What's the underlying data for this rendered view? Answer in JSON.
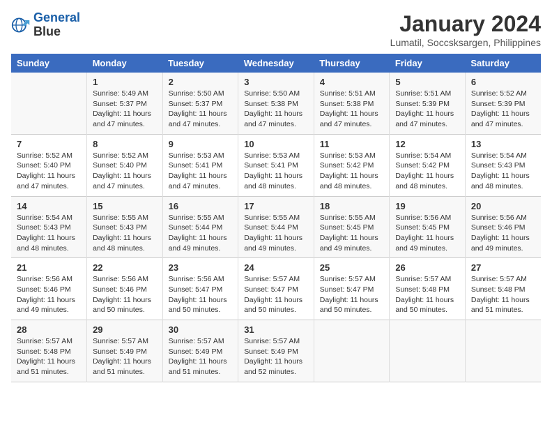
{
  "logo": {
    "line1": "General",
    "line2": "Blue"
  },
  "title": "January 2024",
  "location": "Lumatil, Soccsksargen, Philippines",
  "headers": [
    "Sunday",
    "Monday",
    "Tuesday",
    "Wednesday",
    "Thursday",
    "Friday",
    "Saturday"
  ],
  "weeks": [
    [
      {
        "day": "",
        "text": ""
      },
      {
        "day": "1",
        "text": "Sunrise: 5:49 AM\nSunset: 5:37 PM\nDaylight: 11 hours\nand 47 minutes."
      },
      {
        "day": "2",
        "text": "Sunrise: 5:50 AM\nSunset: 5:37 PM\nDaylight: 11 hours\nand 47 minutes."
      },
      {
        "day": "3",
        "text": "Sunrise: 5:50 AM\nSunset: 5:38 PM\nDaylight: 11 hours\nand 47 minutes."
      },
      {
        "day": "4",
        "text": "Sunrise: 5:51 AM\nSunset: 5:38 PM\nDaylight: 11 hours\nand 47 minutes."
      },
      {
        "day": "5",
        "text": "Sunrise: 5:51 AM\nSunset: 5:39 PM\nDaylight: 11 hours\nand 47 minutes."
      },
      {
        "day": "6",
        "text": "Sunrise: 5:52 AM\nSunset: 5:39 PM\nDaylight: 11 hours\nand 47 minutes."
      }
    ],
    [
      {
        "day": "7",
        "text": "Sunrise: 5:52 AM\nSunset: 5:40 PM\nDaylight: 11 hours\nand 47 minutes."
      },
      {
        "day": "8",
        "text": "Sunrise: 5:52 AM\nSunset: 5:40 PM\nDaylight: 11 hours\nand 47 minutes."
      },
      {
        "day": "9",
        "text": "Sunrise: 5:53 AM\nSunset: 5:41 PM\nDaylight: 11 hours\nand 47 minutes."
      },
      {
        "day": "10",
        "text": "Sunrise: 5:53 AM\nSunset: 5:41 PM\nDaylight: 11 hours\nand 48 minutes."
      },
      {
        "day": "11",
        "text": "Sunrise: 5:53 AM\nSunset: 5:42 PM\nDaylight: 11 hours\nand 48 minutes."
      },
      {
        "day": "12",
        "text": "Sunrise: 5:54 AM\nSunset: 5:42 PM\nDaylight: 11 hours\nand 48 minutes."
      },
      {
        "day": "13",
        "text": "Sunrise: 5:54 AM\nSunset: 5:43 PM\nDaylight: 11 hours\nand 48 minutes."
      }
    ],
    [
      {
        "day": "14",
        "text": "Sunrise: 5:54 AM\nSunset: 5:43 PM\nDaylight: 11 hours\nand 48 minutes."
      },
      {
        "day": "15",
        "text": "Sunrise: 5:55 AM\nSunset: 5:43 PM\nDaylight: 11 hours\nand 48 minutes."
      },
      {
        "day": "16",
        "text": "Sunrise: 5:55 AM\nSunset: 5:44 PM\nDaylight: 11 hours\nand 49 minutes."
      },
      {
        "day": "17",
        "text": "Sunrise: 5:55 AM\nSunset: 5:44 PM\nDaylight: 11 hours\nand 49 minutes."
      },
      {
        "day": "18",
        "text": "Sunrise: 5:55 AM\nSunset: 5:45 PM\nDaylight: 11 hours\nand 49 minutes."
      },
      {
        "day": "19",
        "text": "Sunrise: 5:56 AM\nSunset: 5:45 PM\nDaylight: 11 hours\nand 49 minutes."
      },
      {
        "day": "20",
        "text": "Sunrise: 5:56 AM\nSunset: 5:46 PM\nDaylight: 11 hours\nand 49 minutes."
      }
    ],
    [
      {
        "day": "21",
        "text": "Sunrise: 5:56 AM\nSunset: 5:46 PM\nDaylight: 11 hours\nand 49 minutes."
      },
      {
        "day": "22",
        "text": "Sunrise: 5:56 AM\nSunset: 5:46 PM\nDaylight: 11 hours\nand 50 minutes."
      },
      {
        "day": "23",
        "text": "Sunrise: 5:56 AM\nSunset: 5:47 PM\nDaylight: 11 hours\nand 50 minutes."
      },
      {
        "day": "24",
        "text": "Sunrise: 5:57 AM\nSunset: 5:47 PM\nDaylight: 11 hours\nand 50 minutes."
      },
      {
        "day": "25",
        "text": "Sunrise: 5:57 AM\nSunset: 5:47 PM\nDaylight: 11 hours\nand 50 minutes."
      },
      {
        "day": "26",
        "text": "Sunrise: 5:57 AM\nSunset: 5:48 PM\nDaylight: 11 hours\nand 50 minutes."
      },
      {
        "day": "27",
        "text": "Sunrise: 5:57 AM\nSunset: 5:48 PM\nDaylight: 11 hours\nand 51 minutes."
      }
    ],
    [
      {
        "day": "28",
        "text": "Sunrise: 5:57 AM\nSunset: 5:48 PM\nDaylight: 11 hours\nand 51 minutes."
      },
      {
        "day": "29",
        "text": "Sunrise: 5:57 AM\nSunset: 5:49 PM\nDaylight: 11 hours\nand 51 minutes."
      },
      {
        "day": "30",
        "text": "Sunrise: 5:57 AM\nSunset: 5:49 PM\nDaylight: 11 hours\nand 51 minutes."
      },
      {
        "day": "31",
        "text": "Sunrise: 5:57 AM\nSunset: 5:49 PM\nDaylight: 11 hours\nand 52 minutes."
      },
      {
        "day": "",
        "text": ""
      },
      {
        "day": "",
        "text": ""
      },
      {
        "day": "",
        "text": ""
      }
    ]
  ]
}
